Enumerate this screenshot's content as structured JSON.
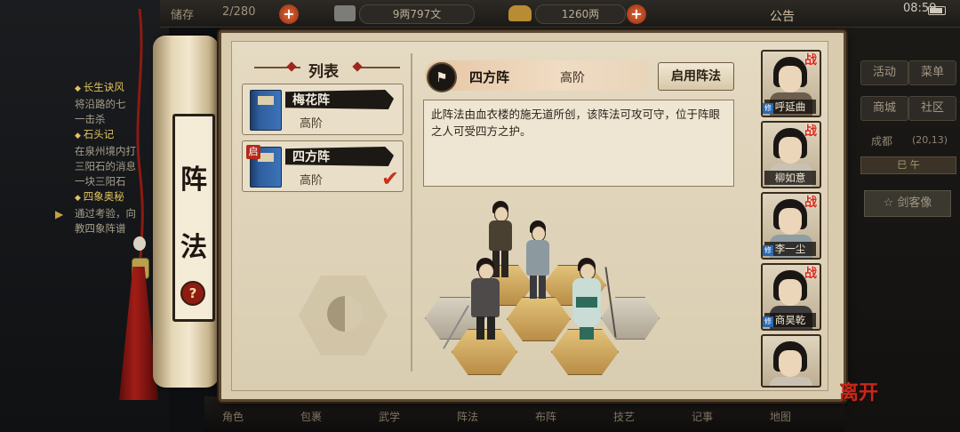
{
  "topbar": {
    "capacity_label": "储存",
    "capacity_value": "2/280",
    "money": "9两797文",
    "gold": "1260两",
    "announcement": "公告",
    "time": "08:59"
  },
  "quests": [
    {
      "title": "长生诀风",
      "desc": [
        "将沿路的七",
        "一击杀"
      ]
    },
    {
      "title": "石头记",
      "desc": [
        "在泉州境内打",
        "三阳石的消息",
        "一块三阳石"
      ]
    },
    {
      "title": "四象奥秘",
      "desc": [
        "通过考验，向",
        "教四象阵谱"
      ]
    }
  ],
  "right_menu": {
    "buttons": [
      "活动",
      "菜单",
      "商城",
      "社区"
    ],
    "location": "成都",
    "coords": "(20,13)",
    "time_of_day": "巳 午",
    "character_btn": "剑客像"
  },
  "scroll": {
    "title_chars": [
      "阵",
      "法"
    ],
    "help": "?"
  },
  "list": {
    "header": "列表",
    "items": [
      {
        "name": "梅花阵",
        "grade": "高阶",
        "active": false
      },
      {
        "name": "四方阵",
        "grade": "高阶",
        "active": true,
        "badge": "启"
      }
    ]
  },
  "detail": {
    "name": "四方阵",
    "grade": "高阶",
    "apply_button": "启用阵法",
    "description": "此阵法由血衣楼的施无道所创，该阵法可攻可守，位于阵眼之人可受四方之护。"
  },
  "party": [
    {
      "name": "呼延曲",
      "in_battle": true,
      "war_mark": "战",
      "cult_mark": "修"
    },
    {
      "name": "柳如意",
      "in_battle": true,
      "war_mark": "战",
      "cult_mark": ""
    },
    {
      "name": "李一尘",
      "in_battle": true,
      "war_mark": "战",
      "cult_mark": "修"
    },
    {
      "name": "商昊乾",
      "in_battle": true,
      "war_mark": "战",
      "cult_mark": "修"
    },
    {
      "name": "",
      "in_battle": false,
      "war_mark": "",
      "cult_mark": ""
    }
  ],
  "bottom_bar": [
    "角色",
    "包裹",
    "武学",
    "阵法",
    "布阵",
    "技艺",
    "记事",
    "地图"
  ],
  "exit_label": "离开",
  "colors": {
    "parchment": "#e5dac2",
    "panel_border": "#5a4630",
    "accent_red": "#c8281a",
    "book_blue": "#2f5f9f"
  }
}
